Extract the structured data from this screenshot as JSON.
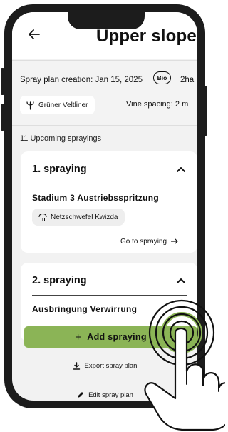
{
  "header": {
    "back_icon": "arrow-left-icon",
    "title": "Upper slope"
  },
  "plan_info": {
    "creation": "Spray plan creation: Jan 15, 2025",
    "bio_badge": "Bio",
    "area": "2ha",
    "grape_variety": "Grüner Veltliner",
    "grape_icon": "grape-vine-icon",
    "vine_spacing": "Vine spacing: 2 m"
  },
  "upcoming_label": "11 Upcoming sprayings",
  "sprayings": [
    {
      "title": "1. spraying",
      "expanded_icon": "chevron-up-icon",
      "stage": "Stadium 3 Austriebsspritzung",
      "product": "Netzschwefel Kwizda",
      "product_icon": "spray-drops-icon",
      "goto_label": "Go to spraying",
      "goto_icon": "arrow-right-icon"
    },
    {
      "title": "2. spraying",
      "expanded_icon": "chevron-up-icon",
      "stage": "Ausbringung Verwirrung"
    }
  ],
  "actions": {
    "add_label": "Add spraying",
    "add_icon": "plus",
    "export_label": "Export spray plan",
    "export_icon": "download-icon",
    "edit_label": "Edit spray plan",
    "edit_icon": "pencil-icon"
  },
  "colors": {
    "accent_green": "#8bb456",
    "phone_frame": "#1c1c1c",
    "screen_bg": "#f2f2f2",
    "card_bg": "#ffffff"
  }
}
